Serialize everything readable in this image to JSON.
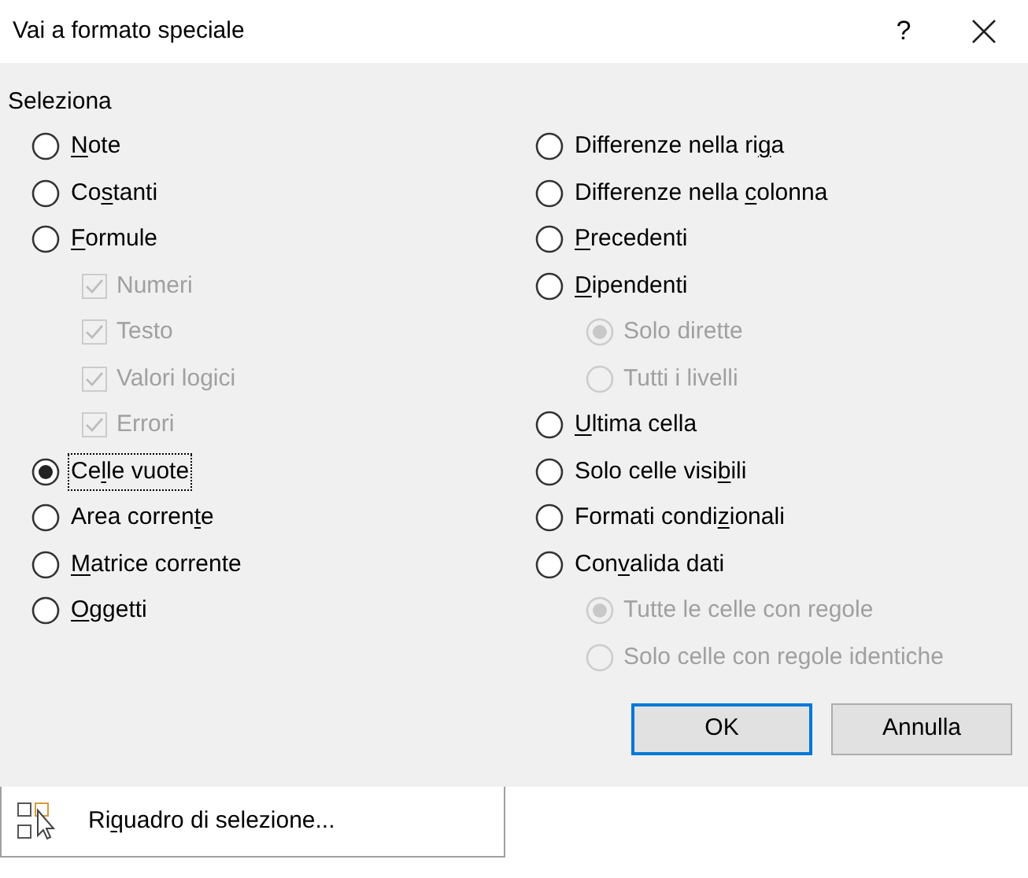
{
  "window": {
    "title": "Vai a formato speciale",
    "help": "?"
  },
  "group": {
    "title": "Seleziona"
  },
  "left": [
    {
      "kind": "radio",
      "label": {
        "key": "N",
        "after": "ote"
      },
      "selected": false,
      "focused": false
    },
    {
      "kind": "radio",
      "label": {
        "before": "Co",
        "key": "s",
        "after": "tanti"
      },
      "selected": false,
      "focused": false
    },
    {
      "kind": "radio",
      "label": {
        "key": "F",
        "after": "ormule"
      },
      "selected": false,
      "focused": false,
      "children": [
        {
          "kind": "checkbox",
          "label": "Numeri",
          "checked": true,
          "disabled": true
        },
        {
          "kind": "checkbox",
          "label": "Testo",
          "checked": true,
          "disabled": true
        },
        {
          "kind": "checkbox",
          "label": "Valori logici",
          "checked": true,
          "disabled": true
        },
        {
          "kind": "checkbox",
          "label": "Errori",
          "checked": true,
          "disabled": true
        }
      ]
    },
    {
      "kind": "radio",
      "label": {
        "before": "Ce",
        "key": "l",
        "after": "le vuote"
      },
      "selected": true,
      "focused": true
    },
    {
      "kind": "radio",
      "label": {
        "before": "Area corren",
        "key": "t",
        "after": "e"
      },
      "selected": false,
      "focused": false
    },
    {
      "kind": "radio",
      "label": {
        "key": "M",
        "after": "atrice corrente"
      },
      "selected": false,
      "focused": false
    },
    {
      "kind": "radio",
      "label": {
        "key": "O",
        "after": "ggetti"
      },
      "selected": false,
      "focused": false
    }
  ],
  "right": [
    {
      "kind": "radio",
      "label": {
        "before": "Differenze nella ri",
        "key": "g",
        "after": "a"
      },
      "selected": false,
      "focused": false
    },
    {
      "kind": "radio",
      "label": {
        "before": "Differenze nella ",
        "key": "c",
        "after": "olonna"
      },
      "selected": false,
      "focused": false
    },
    {
      "kind": "radio",
      "label": {
        "key": "P",
        "after": "recedenti"
      },
      "selected": false,
      "focused": false
    },
    {
      "kind": "radio",
      "label": {
        "key": "D",
        "after": "ipendenti"
      },
      "selected": false,
      "focused": false,
      "children": [
        {
          "kind": "radio",
          "label": "Solo dirette",
          "selected": true,
          "disabled": true
        },
        {
          "kind": "radio",
          "label": "Tutti i livelli",
          "selected": false,
          "disabled": true
        }
      ]
    },
    {
      "kind": "radio",
      "label": {
        "key": "U",
        "after": "ltima cella"
      },
      "selected": false,
      "focused": false
    },
    {
      "kind": "radio",
      "label": {
        "before": "Solo celle visi",
        "key": "b",
        "after": "ili"
      },
      "selected": false,
      "focused": false
    },
    {
      "kind": "radio",
      "label": {
        "before": "Formati condi",
        "key": "z",
        "after": "ionali"
      },
      "selected": false,
      "focused": false
    },
    {
      "kind": "radio",
      "label": {
        "before": "Con",
        "key": "v",
        "after": "alida dati"
      },
      "selected": false,
      "focused": false,
      "children": [
        {
          "kind": "radio",
          "label": "Tutte le celle con regole",
          "selected": true,
          "disabled": true
        },
        {
          "kind": "radio",
          "label": "Solo celle con regole identiche",
          "selected": false,
          "disabled": true
        }
      ]
    }
  ],
  "buttons": [
    {
      "label": "OK",
      "default": true
    },
    {
      "label": "Annulla",
      "default": false
    }
  ],
  "menu_item": {
    "label": {
      "before": "Ri",
      "key": "q",
      "after": "uadro di selezione..."
    }
  }
}
